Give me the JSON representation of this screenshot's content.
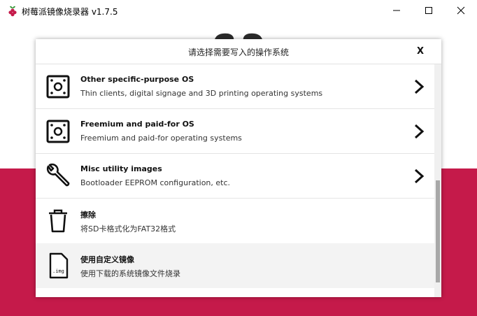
{
  "window": {
    "title": "树莓派镜像烧录器 v1.7.5",
    "icon": "raspberry-pi-logo",
    "controls": [
      "minimize-icon",
      "maximize-icon",
      "close-icon"
    ]
  },
  "dialog": {
    "title": "请选择需要写入的操作系统",
    "close_label": "X",
    "items": [
      {
        "name": "Other specific-purpose OS",
        "description": "Thin clients, digital signage and 3D printing operating systems",
        "icon": "board-icon",
        "has_submenu": true
      },
      {
        "name": "Freemium and paid-for OS",
        "description": "Freemium and paid-for operating systems",
        "icon": "board-icon",
        "has_submenu": true
      },
      {
        "name": "Misc utility images",
        "description": "Bootloader EEPROM configuration, etc.",
        "icon": "wrench-icon",
        "has_submenu": true
      },
      {
        "name": "擦除",
        "description": "将SD卡格式化为FAT32格式",
        "icon": "trash-icon",
        "has_submenu": false
      },
      {
        "name": "使用自定义镜像",
        "description": "使用下载的系统镜像文件烧录",
        "icon": "img-file-icon",
        "file_badge": ".img",
        "has_submenu": false,
        "highlighted": true
      }
    ]
  },
  "colors": {
    "brand": "#c51a4a",
    "highlight_row": "#f3f3f3",
    "scroll_thumb": "#a8a8a8"
  }
}
